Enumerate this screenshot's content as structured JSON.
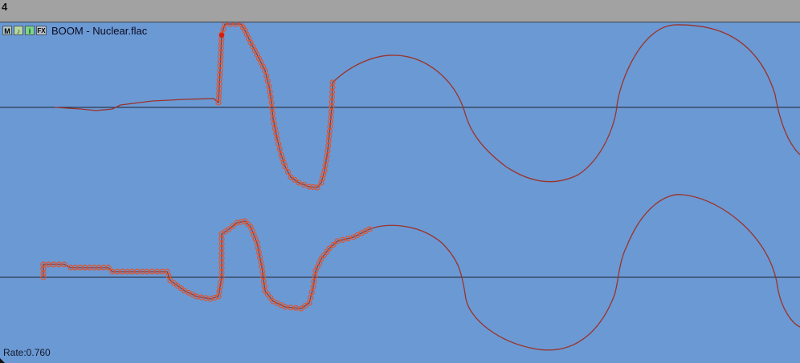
{
  "window": {
    "track_number": "4"
  },
  "item": {
    "take_name": "BOOM - Nuclear.flac",
    "rate_label": "Rate:0.760",
    "buttons": {
      "mute": "M",
      "notes": "♪",
      "info": "i",
      "fx": "FX"
    }
  },
  "colors": {
    "background": "#6b99d4",
    "waveform": "#9b3328",
    "envelope_point_fill": "#e0542c",
    "selected_point": "#d81c0c",
    "center_line": "#1d2430",
    "header_bar": "#a2a2a2"
  },
  "icons": [
    "mute-button",
    "notes-icon",
    "info-icon",
    "fx-icon"
  ]
}
